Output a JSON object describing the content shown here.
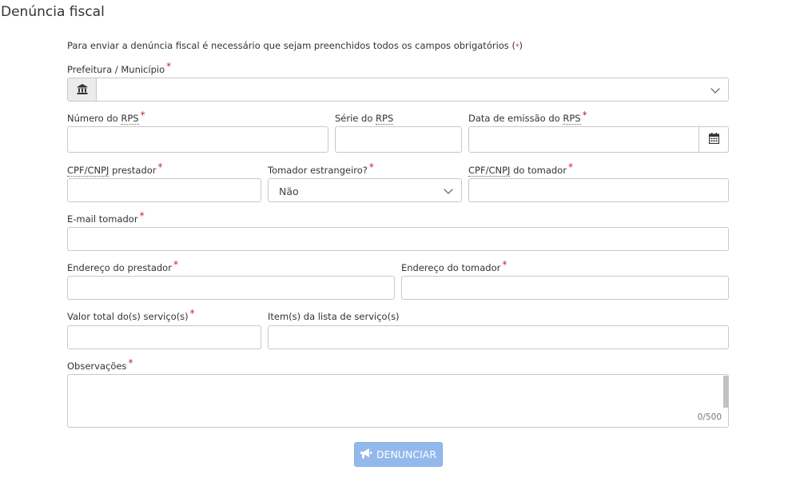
{
  "page": {
    "title": "Denúncia fiscal",
    "intro_text": "Para enviar a denúncia fiscal é necessário que sejam preenchidos todos os campos obrigatórios (",
    "intro_star": "*",
    "intro_close": ")"
  },
  "required_mark": "*",
  "fields": {
    "prefeitura": {
      "label": "Prefeitura / Município",
      "value": ""
    },
    "numero_rps": {
      "label_prefix": "Número do ",
      "label_abbr": "RPS",
      "value": ""
    },
    "serie_rps": {
      "label_prefix": "Série do ",
      "label_abbr": "RPS",
      "value": ""
    },
    "data_emissao": {
      "label_prefix": "Data de emissão do ",
      "label_abbr": "RPS",
      "value": ""
    },
    "cpf_prestador": {
      "label_abbr": "CPF/CNPJ",
      "label_suffix": " prestador",
      "value": ""
    },
    "tomador_estrangeiro": {
      "label": "Tomador estrangeiro?",
      "selected": "Não"
    },
    "cpf_tomador": {
      "label_abbr": "CPF/CNPJ",
      "label_suffix": " do tomador",
      "value": ""
    },
    "email_tomador": {
      "label": "E-mail tomador",
      "value": ""
    },
    "endereco_prestador": {
      "label": "Endereço do prestador",
      "value": ""
    },
    "endereco_tomador": {
      "label": "Endereço do tomador",
      "value": ""
    },
    "valor_total": {
      "label": "Valor total do(s) serviço(s)",
      "value": ""
    },
    "itens_lista": {
      "label": "Item(s) da lista de serviço(s)",
      "value": ""
    },
    "observacoes": {
      "label": "Observações",
      "value": "",
      "counter": "0/500"
    }
  },
  "submit": {
    "label": "DENUNCIAR",
    "icon": "megaphone-icon"
  },
  "icons": {
    "prefeitura_addon": "bank-icon",
    "date_addon": "calendar-icon"
  },
  "colors": {
    "required": "#cc2222",
    "button": "#93b9ec",
    "border": "#c8c8c8"
  }
}
